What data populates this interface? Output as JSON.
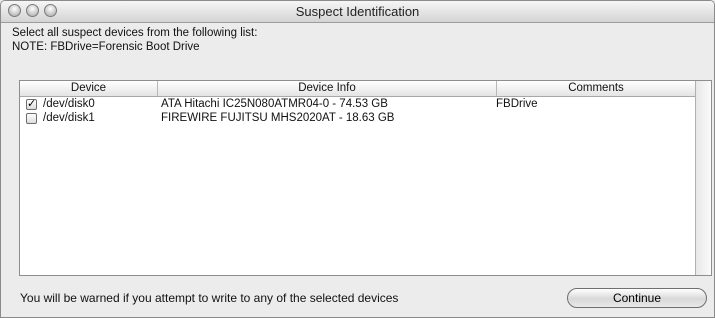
{
  "window": {
    "title": "Suspect Identification"
  },
  "instructions": {
    "line1": "Select all suspect devices from the following list:",
    "line2": "NOTE: FBDrive=Forensic Boot Drive"
  },
  "table": {
    "columns": [
      "Device",
      "Device Info",
      "Comments"
    ],
    "rows": [
      {
        "checked": true,
        "check_glyph": "✓",
        "device": "/dev/disk0",
        "info": "ATA Hitachi IC25N080ATMR04-0 - 74.53 GB",
        "comment": "FBDrive"
      },
      {
        "checked": false,
        "check_glyph": "",
        "device": "/dev/disk1",
        "info": "FIREWIRE FUJITSU MHS2020AT - 18.63 GB",
        "comment": ""
      }
    ]
  },
  "footer": {
    "warning": "You will be warned if you attempt to write to any of the selected devices",
    "continue_label": "Continue"
  }
}
